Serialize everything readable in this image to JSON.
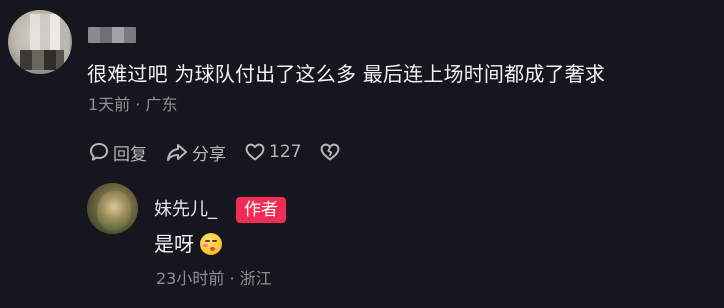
{
  "comment": {
    "text": "很难过吧 为球队付出了这么多 最后连上场时间都成了奢求",
    "time": "1天前",
    "separator": "·",
    "location": "广东",
    "actions": {
      "reply_label": "回复",
      "share_label": "分享",
      "like_count": "127"
    }
  },
  "reply": {
    "username": "妹先儿_",
    "badge": "作者",
    "text": "是呀",
    "time": "23小时前",
    "separator": "·",
    "location": "浙江"
  },
  "colors": {
    "background": "#16161e",
    "badge_bg": "#f12c55",
    "meta_text": "#8e8e94"
  },
  "icons": {
    "reply": "chat-bubble-icon",
    "share": "share-arrow-icon",
    "like": "heart-icon",
    "dislike": "broken-heart-icon",
    "emoji": "shy-smile-emoji-icon"
  }
}
